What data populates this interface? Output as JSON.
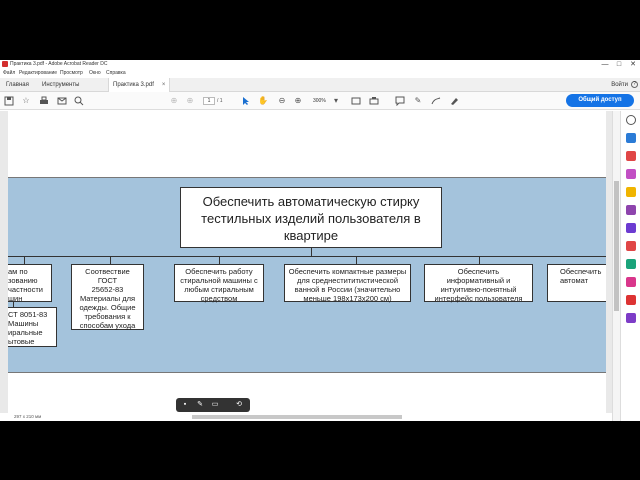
{
  "window": {
    "title": "Практика 3.pdf - Adobe Acrobat Reader DC",
    "minimize": "—",
    "maximize": "□",
    "close": "✕"
  },
  "menu": [
    "Файл",
    "Редактирование",
    "Просмотр",
    "Окно",
    "Справка"
  ],
  "tabs": {
    "home": "Главная",
    "tools": "Инструменты",
    "document": "Практика 3.pdf",
    "close": "×",
    "signin": "Войти",
    "help": "?"
  },
  "toolbar": {
    "page_current": "1",
    "page_total": "/ 1",
    "zoom": "300%",
    "share_label": "Общий доступ"
  },
  "diagram": {
    "root": "Обеспечить автоматическую стирку тестильных изделий пользователя в квартире",
    "children": [
      "ам по\nзованию\nчастности\nшин",
      "Соотвествие ГОСТ\n25652-83\nМатериалы для\nодежды. Общие\nтребования к\nспособам ухода",
      "Обеспечить работу\nстиральной машины с\nлюбым стиральным\nсредством",
      "Обеспечить компактные размеры\nдля среднестититистической\nванной в России (значительно\nменьше 198х173х200 см)",
      "Обеспечить\nинформативный и\nинтуитивно-понятный\nинтерфейс пользователя",
      "Обеспечить\nавтомат"
    ],
    "sub_child": "СТ 8051-83\nМашины\nиральные\nытовые"
  },
  "status": {
    "page_size": "297 x 210 мм"
  },
  "colors": {
    "chart_bg": "#a4c3dc",
    "accent": "#1473e6"
  }
}
